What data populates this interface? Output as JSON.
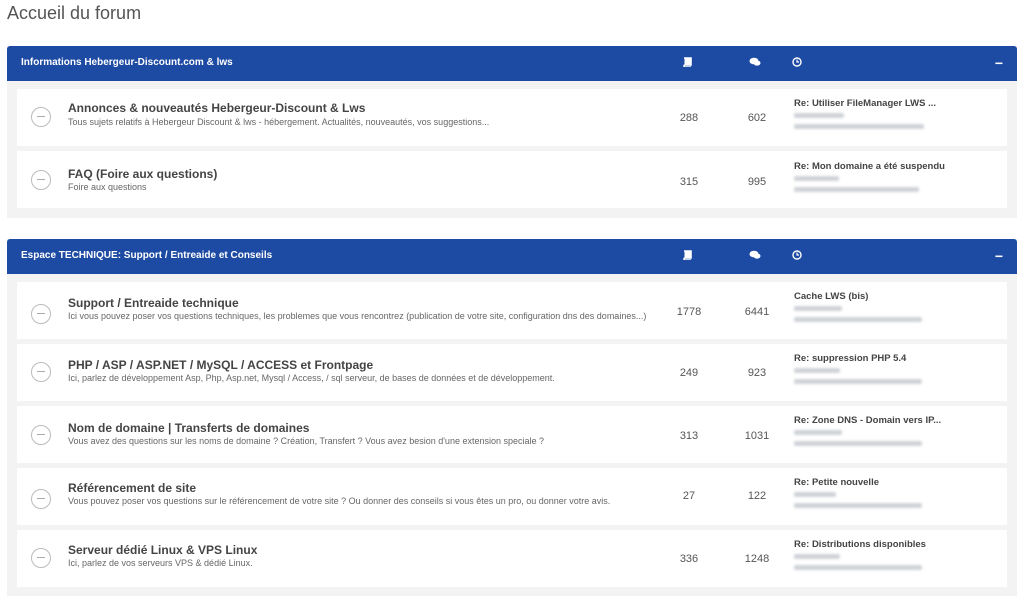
{
  "page_title": "Accueil du forum",
  "categories": [
    {
      "title": "Informations Hebergeur-Discount.com & lws",
      "icons": [
        "book-icon",
        "chat-bubbles-icon",
        "clock-icon"
      ],
      "collapse_label": "−",
      "forums": [
        {
          "name": "Annonces & nouveautés Hebergeur-Discount & Lws",
          "desc": "Tous sujets relatifs à Hebergeur Discount & lws - hébergement. Actualités, nouveautés, vos suggestions...",
          "topics": "288",
          "posts": "602",
          "last": "Re: Utiliser FileManager LWS ..."
        },
        {
          "name": "FAQ (Foire aux questions)",
          "desc": "Foire aux questions",
          "topics": "315",
          "posts": "995",
          "last": "Re: Mon domaine a été suspendu"
        }
      ]
    },
    {
      "title": "Espace TECHNIQUE: Support / Entreaide et Conseils",
      "icons": [
        "book-icon",
        "chat-bubbles-icon",
        "clock-icon"
      ],
      "collapse_label": "−",
      "forums": [
        {
          "name": "Support / Entreaide technique",
          "desc": "Ici vous pouvez poser vos questions techniques, les problemes que vous rencontrez (publication de votre site, configuration dns des domaines...)",
          "topics": "1778",
          "posts": "6441",
          "last": "Cache LWS (bis)"
        },
        {
          "name": "PHP / ASP / ASP.NET / MySQL / ACCESS et Frontpage",
          "desc": "Ici, parlez de développement Asp, Php, Asp.net, Mysql / Access, / sql serveur, de bases de données et de développement.",
          "topics": "249",
          "posts": "923",
          "last": "Re: suppression PHP 5.4"
        },
        {
          "name": "Nom de domaine | Transferts de domaines",
          "desc": "Vous avez des questions sur les noms de domaine ? Création, Transfert ? Vous avez besion d'une extension speciale ?",
          "topics": "313",
          "posts": "1031",
          "last": "Re: Zone DNS - Domain vers IP..."
        },
        {
          "name": "Référencement de site",
          "desc": "Vous pouvez poser vos questions sur le référencement de votre site ? Ou donner des conseils si vous êtes un pro, ou donner votre avis.",
          "topics": "27",
          "posts": "122",
          "last": "Re: Petite nouvelle"
        },
        {
          "name": "Serveur dédié Linux & VPS Linux",
          "desc": "Ici, parlez de vos serveurs VPS & dédié Linux.",
          "topics": "336",
          "posts": "1248",
          "last": "Re: Distributions disponibles"
        }
      ]
    }
  ]
}
